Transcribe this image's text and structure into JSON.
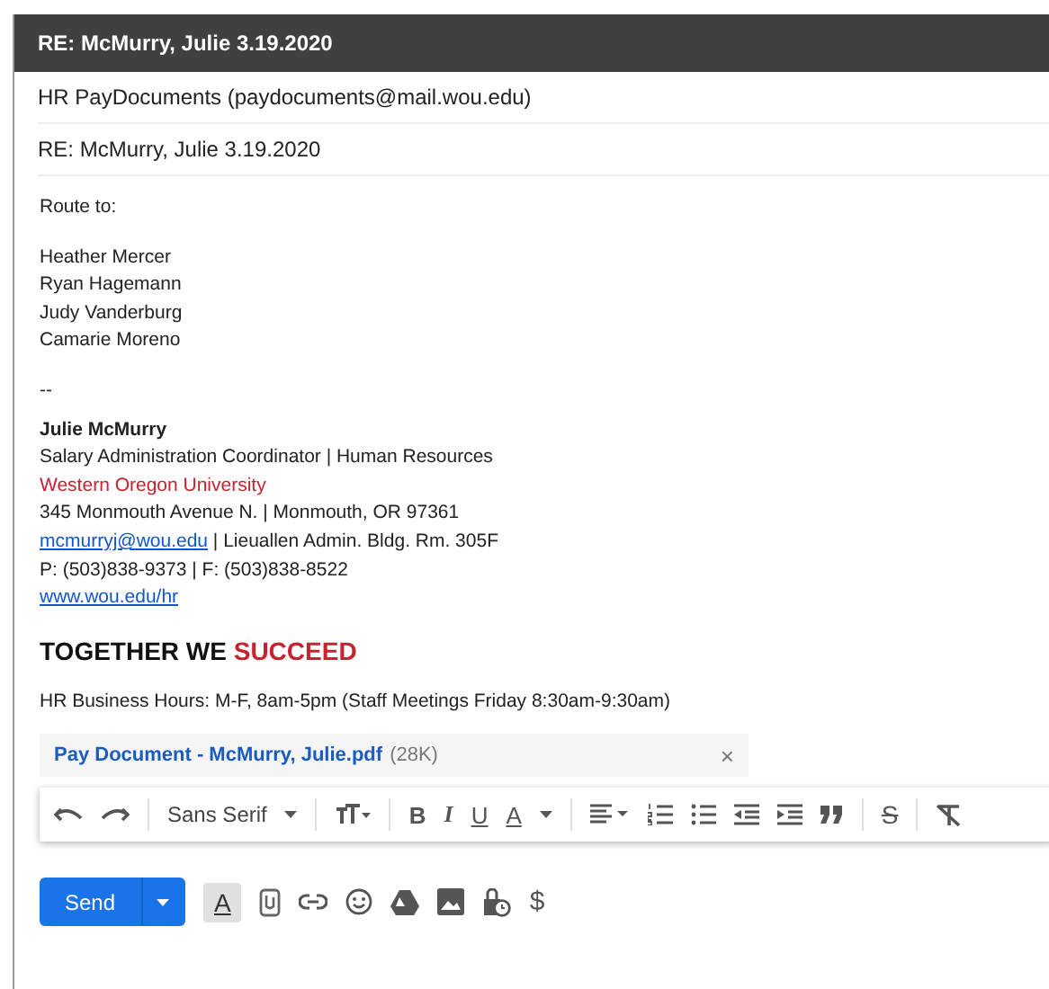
{
  "window": {
    "title": "RE: McMurry, Julie 3.19.2020"
  },
  "from": "HR PayDocuments (paydocuments@mail.wou.edu)",
  "subject": "RE: McMurry, Julie 3.19.2020",
  "body": {
    "intro": "Route to:",
    "names": [
      "Heather Mercer",
      "Ryan Hagemann",
      "Judy Vanderburg",
      "Camarie Moreno"
    ],
    "separator": "--",
    "signature": {
      "name": "Julie McMurry",
      "title": "Salary Administration Coordinator | Human Resources",
      "organization": "Western Oregon University",
      "address": "345 Monmouth Avenue N. | Monmouth, OR 97361",
      "email": "mcmurryj@wou.edu",
      "office": " | Lieuallen Admin. Bldg. Rm. 305F",
      "phone": "P: (503)838-9373 | F: (503)838-8522",
      "website": "www.wou.edu/hr",
      "slogan_start": "TOGETHER WE ",
      "slogan_highlight": "SUCCEED"
    },
    "hours": "HR Business Hours: M-F, 8am-5pm (Staff Meetings Friday 8:30am-9:30am)"
  },
  "attachment": {
    "name": "Pay Document - McMurry, Julie.pdf",
    "size": "(28K)",
    "remove": "×"
  },
  "format_toolbar": {
    "font": "Sans Serif",
    "bold": "B",
    "italic": "I",
    "underline": "U",
    "text_color": "A",
    "strikethrough": "S"
  },
  "footer": {
    "send": "Send",
    "formatting": {
      "label": "A",
      "selected": true
    },
    "money": "$"
  }
}
